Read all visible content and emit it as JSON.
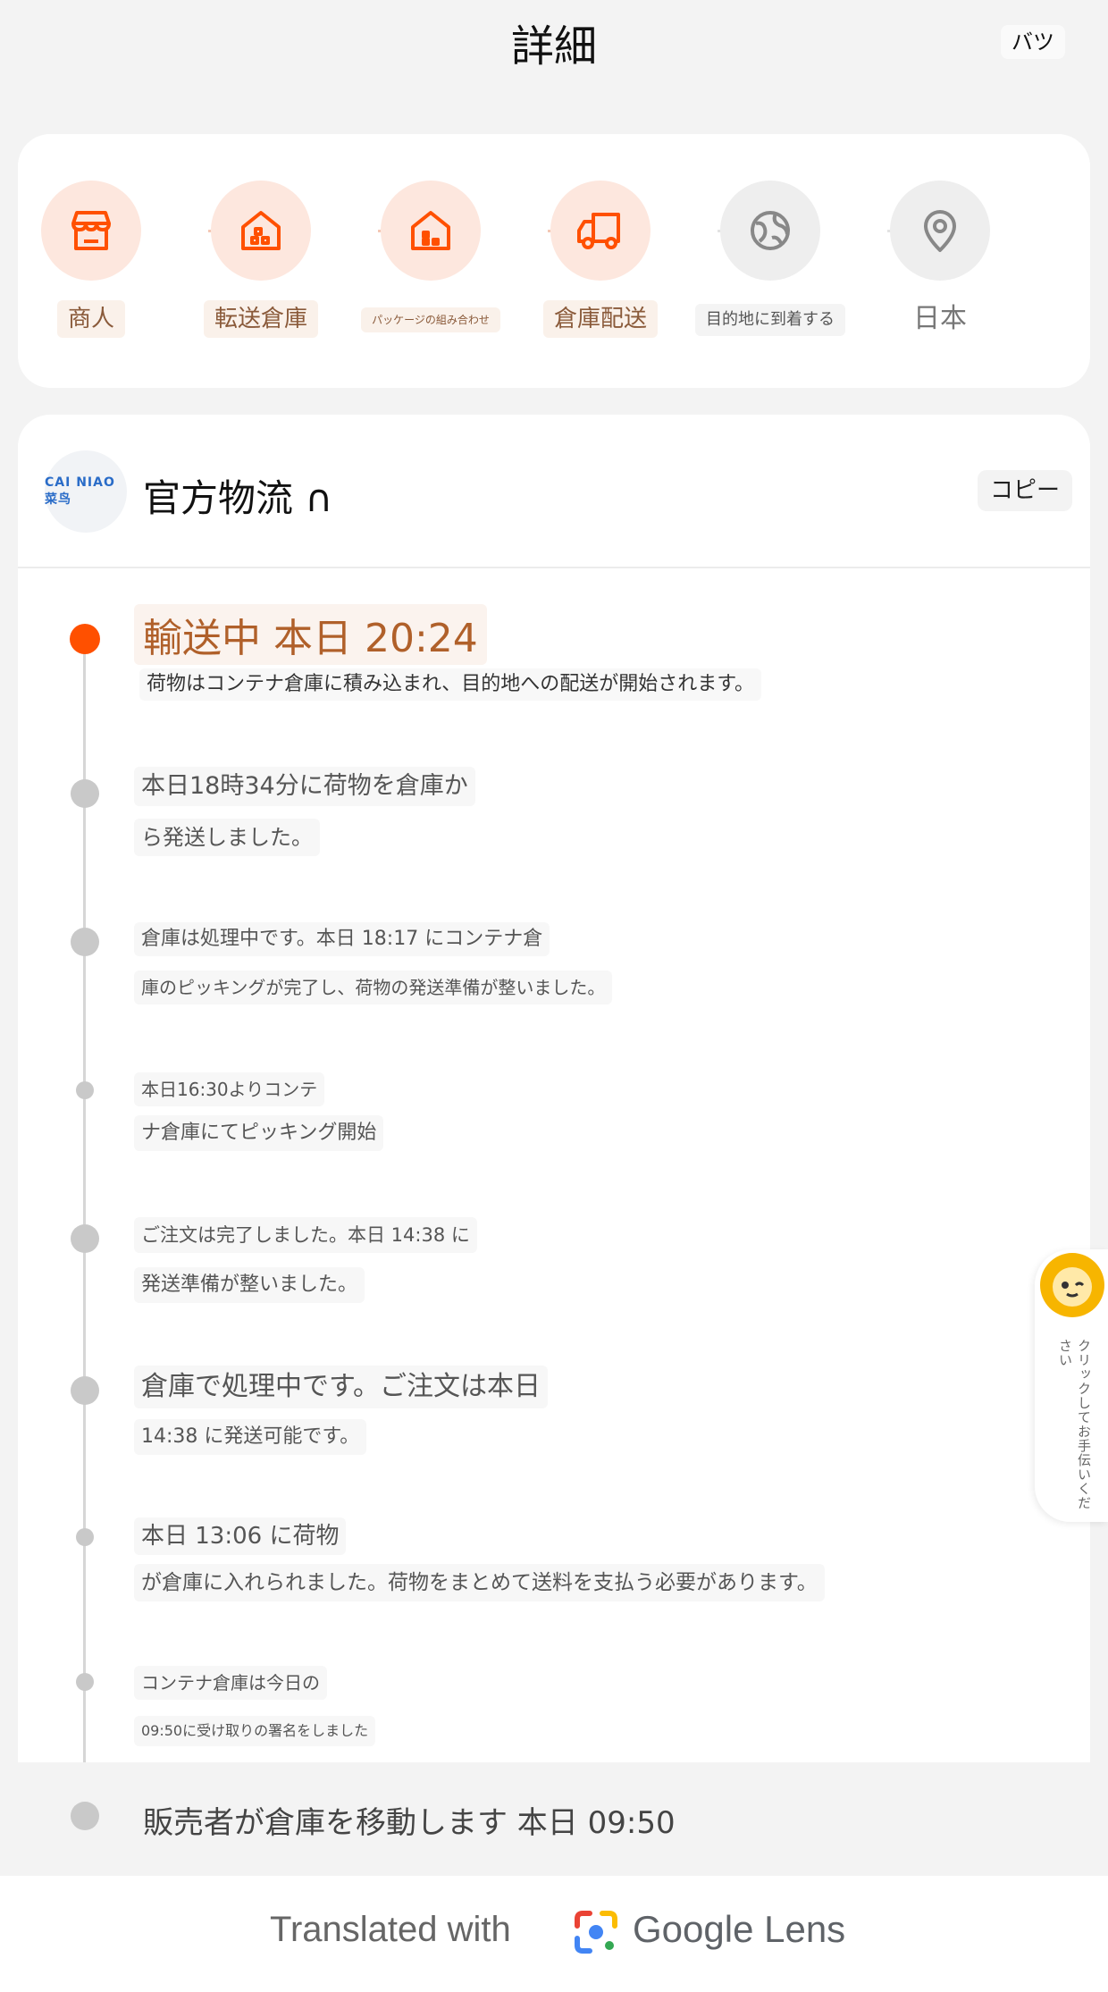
{
  "header": {
    "title": "詳細",
    "close_label": "バツ"
  },
  "steps": [
    {
      "label": "商人",
      "icon": "store-icon",
      "state": "active"
    },
    {
      "label": "転送倉庫",
      "icon": "warehouse-icon",
      "state": "active"
    },
    {
      "label": "パッケージの組み合わせ",
      "icon": "house-icon",
      "state": "active"
    },
    {
      "label": "倉庫配送",
      "icon": "truck-icon",
      "state": "active"
    },
    {
      "label": "目的地に到着する",
      "icon": "globe-icon",
      "state": "inactive"
    },
    {
      "label": "日本",
      "icon": "location-pin-icon",
      "state": "inactive"
    }
  ],
  "carrier": {
    "logo_text": "CAI NIAO 菜鸟",
    "name": "官方物流 ∩",
    "copy_label": "コピー"
  },
  "events": [
    {
      "title": "輸送中 本日 20:24",
      "line1": "荷物はコンテナ倉庫に積み込まれ、目的地への配送が開始されます。"
    },
    {
      "line1": "本日18時34分に荷物を倉庫か",
      "line2": "ら発送しました。"
    },
    {
      "line1": "倉庫は処理中です。本日 18:17 にコンテナ倉",
      "line2": "庫のピッキングが完了し、荷物の発送準備が整いました。"
    },
    {
      "line1": "本日16:30よりコンテ",
      "line2": "ナ倉庫にてピッキング開始"
    },
    {
      "line1": "ご注文は完了しました。本日 14:38 に",
      "line2": "発送準備が整いました。"
    },
    {
      "line1": "倉庫で処理中です。ご注文は本日",
      "line2": "14:38 に発送可能です。"
    },
    {
      "line1": "本日 13:06 に荷物",
      "line2": "が倉庫に入れられました。荷物をまとめて送料を支払う必要があります。"
    },
    {
      "line1": "コンテナ倉庫は今日の",
      "line2": "09:50に受け取りの署名をしました"
    },
    {
      "line1": "販売者が倉庫を移動します 本日 09:50"
    }
  ],
  "helper": {
    "text": "クリックしてお手伝いください"
  },
  "footer": {
    "prefix": "Translated with",
    "brand": "Google Lens"
  },
  "colors": {
    "accent": "#ff5000",
    "accent_bg": "#fde7de",
    "label_text": "#8a5a3a"
  }
}
